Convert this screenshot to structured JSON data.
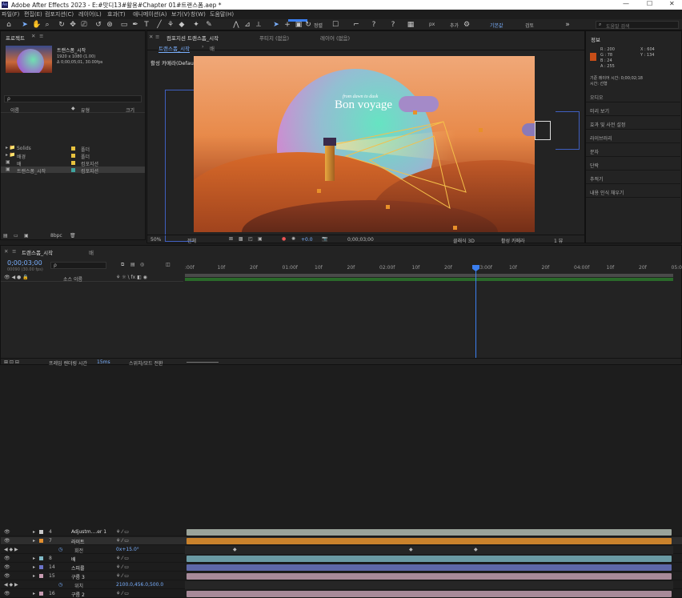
{
  "window": {
    "title": "Adobe After Effects 2023 - E:#맛디13#활용#Chapter 01#트랜스폼.aep *"
  },
  "menu": [
    "파일(F)",
    "편집(E)",
    "컴포지션(C)",
    "레이어(L)",
    "효과(T)",
    "애니메이션(A)",
    "보기(V)",
    "창(W)",
    "도움말(H)"
  ],
  "toolbar": {
    "snap_label": "정렬",
    "px_label": "px",
    "extra_label": "추가",
    "workspace": "기본값",
    "workspace2": "검토",
    "search_placeholder": "도움말 검색"
  },
  "project": {
    "tab": "프로젝트",
    "comp_name": "트랜스폼_시작",
    "comp_meta1": "1920 x 1080 (1.00)",
    "comp_meta2": "Δ 0;00;05;01, 30.00fps",
    "search_placeholder": "ρ",
    "col_name": "이름",
    "col_type": "유형",
    "col_size": "크기",
    "items": [
      {
        "name": "Solids",
        "type": "폴더",
        "color": "#e8c23e"
      },
      {
        "name": "배경",
        "type": "폴더",
        "color": "#e8c23e"
      },
      {
        "name": "배",
        "type": "컴포지션",
        "color": "#e8c23e"
      },
      {
        "name": "트랜스폼_시작",
        "type": "컴포지션",
        "color": "#3fa39e"
      }
    ],
    "bpc": "8bpc"
  },
  "viewer": {
    "comp_tab": "컴포지션 트랜스폼_시작",
    "footage_tab": "푸티지 (없음)",
    "layer_tab": "레이어 (없음)",
    "sub_tab": "트랜스폼_시작",
    "sub_tab2": "배",
    "camera_label": "활성 카메라(Default)",
    "art_subtitle": "from dawn to dusk",
    "art_title": "Bon voyage",
    "zoom": "50%",
    "resolution": "전체",
    "exposure": "+0.0",
    "timecode": "0;00;03;00",
    "renderer": "클래식 3D",
    "camera_select": "활성 카메라",
    "view_count": "1 뷰"
  },
  "info": {
    "tab": "정보",
    "r": "R : 200",
    "g": "G : 78",
    "b": "B : 24",
    "a": "A : 255",
    "x": "X : 604",
    "y": "Y : 134",
    "frame_label": "기준 레이어 시간: 0;00;02;18",
    "time_label": "시간: 선형",
    "panels": [
      "오디오",
      "미리 보기",
      "효과 및 사전 설정",
      "라이브러리",
      "문자",
      "단락",
      "추적기",
      "내용 인식 채우기"
    ]
  },
  "timeline": {
    "tab1": "트랜스폼_시작",
    "tab2": "배",
    "timecode": "0;00;03;00",
    "timecode_sub": "00090 (30.00 fps)",
    "search_placeholder": "ρ",
    "col_source": "소스 이름",
    "ruler": [
      ":00f",
      "10f",
      "20f",
      "01:00f",
      "10f",
      "20f",
      "02:00f",
      "10f",
      "20f",
      "03:00f",
      "10f",
      "20f",
      "04:00f",
      "10f",
      "20f",
      "05:0"
    ],
    "layers": [
      {
        "num": "4",
        "name": "Adjustm....er 1",
        "color": "#c9c9c9",
        "bar": "#9aa39a"
      },
      {
        "num": "7",
        "name": "라이트",
        "color": "#e38f2f",
        "bar": "#c9822c"
      },
      {
        "num": "",
        "name": "회전",
        "value": "0x+15.0°",
        "prop": true
      },
      {
        "num": "8",
        "name": "배",
        "color": "#7fb9c6",
        "bar": "#6a9aa3"
      },
      {
        "num": "14",
        "name": "스피룰",
        "color": "#6b73c9",
        "bar": "#5e68a8"
      },
      {
        "num": "15",
        "name": "구름 3",
        "color": "#c79bb1",
        "bar": "#a88a99"
      },
      {
        "num": "",
        "name": "위치",
        "value": "2100.0,456.0,500.0",
        "prop": true
      },
      {
        "num": "16",
        "name": "구름 2",
        "color": "#c79bb1",
        "bar": "#a88a99"
      }
    ],
    "status_left": "프레임 렌더링 시간",
    "status_time": "15ms",
    "status_right": "스위치/모드 전환"
  }
}
